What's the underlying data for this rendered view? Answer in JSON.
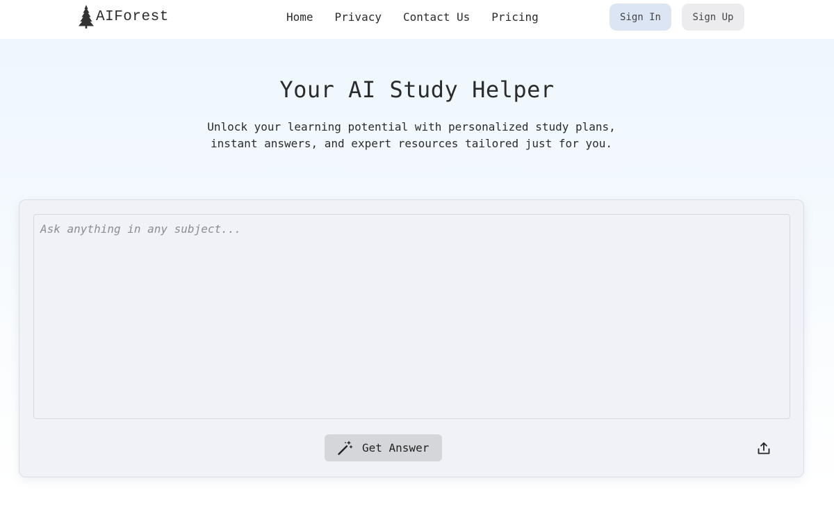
{
  "brand": {
    "name": "AIForest",
    "logo_icon": "pine-tree-icon"
  },
  "nav": {
    "items": [
      {
        "label": "Home"
      },
      {
        "label": "Privacy"
      },
      {
        "label": "Contact Us"
      },
      {
        "label": "Pricing"
      }
    ]
  },
  "auth": {
    "sign_in_label": "Sign In",
    "sign_up_label": "Sign Up"
  },
  "hero": {
    "title": "Your AI Study Helper",
    "subtitle_line1": "Unlock your learning potential with personalized study plans,",
    "subtitle_line2": "instant answers, and expert resources tailored just for you."
  },
  "question_box": {
    "placeholder": "Ask anything in any subject...",
    "value": "",
    "submit_label": "Get Answer",
    "submit_icon": "magic-wand-icon",
    "share_icon": "share-upload-icon"
  },
  "colors": {
    "text": "#2b2b2b",
    "sign_in_bg": "#dbe5f3",
    "sign_up_bg": "#ececef",
    "card_bg": "#f0f2f8",
    "submit_bg": "#d4d6da",
    "hero_bg_top": "#eef7fd"
  }
}
